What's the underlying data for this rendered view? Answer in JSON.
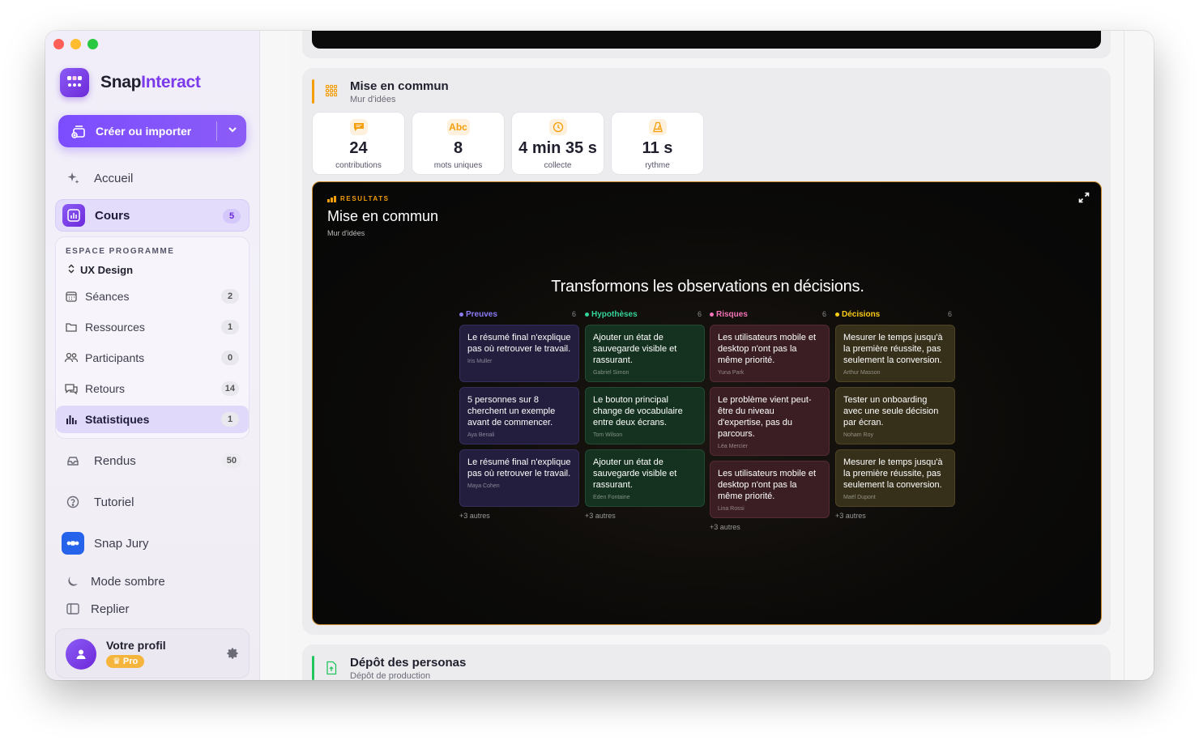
{
  "app": {
    "name_part1": "Snap",
    "name_part2": "Interact"
  },
  "sidebar": {
    "create_label": "Créer ou importer",
    "nav": [
      {
        "label": "Accueil"
      },
      {
        "label": "Cours",
        "badge": "5"
      }
    ],
    "program": {
      "title": "ESPACE PROGRAMME",
      "selected": "UX Design",
      "items": [
        {
          "label": "Séances",
          "badge": "2"
        },
        {
          "label": "Ressources",
          "badge": "1"
        },
        {
          "label": "Participants",
          "badge": "0"
        },
        {
          "label": "Retours",
          "badge": "14"
        },
        {
          "label": "Statistiques",
          "badge": "1"
        }
      ]
    },
    "nav2": [
      {
        "label": "Rendus",
        "badge": "50"
      },
      {
        "label": "Tutoriel"
      },
      {
        "label": "Snap Jury"
      },
      {
        "label": "Mode sombre"
      },
      {
        "label": "Replier"
      }
    ],
    "profile": {
      "name": "Votre profil",
      "badge": "Pro"
    }
  },
  "section": {
    "title": "Mise en commun",
    "subtitle": "Mur d'idées",
    "stats": [
      {
        "icon": "chat-icon",
        "value": "24",
        "label": "contributions"
      },
      {
        "icon": "abc-icon",
        "icon_text": "Abc",
        "value": "8",
        "label": "mots uniques"
      },
      {
        "icon": "clock-icon",
        "value": "4 min 35 s",
        "label": "collecte"
      },
      {
        "icon": "metronome-icon",
        "value": "11 s",
        "label": "rythme"
      }
    ]
  },
  "board": {
    "tag": "RESULTATS",
    "title": "Mise en commun",
    "subtitle": "Mur d'idées",
    "headline": "Transformons les observations en décisions.",
    "columns": [
      {
        "name": "Preuves",
        "count": "6",
        "color": "#8b7cf6",
        "notes": [
          {
            "text": "Le résumé final n'explique pas où retrouver le travail.",
            "author": "Iris Muller"
          },
          {
            "text": "5 personnes sur 8 cherchent un exemple avant de commencer.",
            "author": "Aya Benali"
          },
          {
            "text": "Le résumé final n'explique pas où retrouver le travail.",
            "author": "Maya Cohen"
          }
        ],
        "more": "+3 autres"
      },
      {
        "name": "Hypothèses",
        "count": "6",
        "color": "#34d399",
        "notes": [
          {
            "text": "Ajouter un état de sauvegarde visible et rassurant.",
            "author": "Gabriel Simon"
          },
          {
            "text": "Le bouton principal change de vocabulaire entre deux écrans.",
            "author": "Tom Wilson"
          },
          {
            "text": "Ajouter un état de sauvegarde visible et rassurant.",
            "author": "Eden Fontaine"
          }
        ],
        "more": "+3 autres"
      },
      {
        "name": "Risques",
        "count": "6",
        "color": "#f472b6",
        "notes": [
          {
            "text": "Les utilisateurs mobile et desktop n'ont pas la même priorité.",
            "author": "Yuna Park"
          },
          {
            "text": "Le problème vient peut-être du niveau d'expertise, pas du parcours.",
            "author": "Léa Mercier"
          },
          {
            "text": "Les utilisateurs mobile et desktop n'ont pas la même priorité.",
            "author": "Lina Rossi"
          }
        ],
        "more": "+3 autres"
      },
      {
        "name": "Décisions",
        "count": "6",
        "color": "#facc15",
        "notes": [
          {
            "text": "Mesurer le temps jusqu'à la première réussite, pas seulement la conversion.",
            "author": "Arthur Masson"
          },
          {
            "text": "Tester un onboarding avec une seule décision par écran.",
            "author": "Noham Roy"
          },
          {
            "text": "Mesurer le temps jusqu'à la première réussite, pas seulement la conversion.",
            "author": "Maël Dupont"
          }
        ],
        "more": "+3 autres"
      }
    ]
  },
  "section2": {
    "title": "Dépôt des personas",
    "subtitle": "Dépôt de production"
  }
}
